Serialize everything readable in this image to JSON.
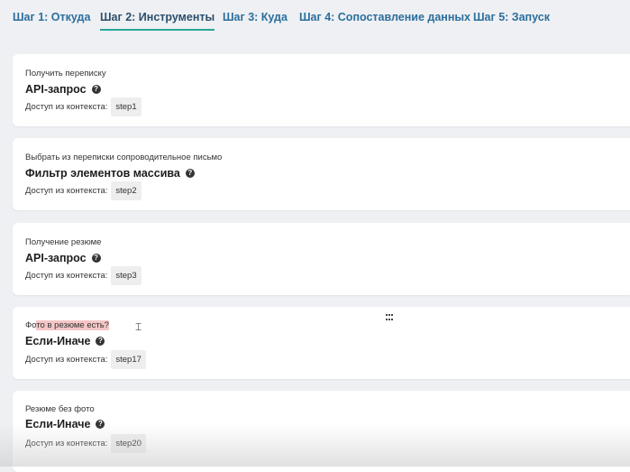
{
  "tabs": [
    {
      "label": "Шаг 1: Откуда",
      "active": false
    },
    {
      "label": "Шаг 2: Инструменты",
      "active": true
    },
    {
      "label": "Шаг 3: Куда",
      "active": false
    },
    {
      "label": "Шаг 4: Сопоставление данных",
      "active": false
    },
    {
      "label": "Шаг 5: Запуск",
      "active": false
    }
  ],
  "context_label": "Доступ из контекста:",
  "steps": [
    {
      "subtitle": "Получить переписку",
      "title": "API-запрос",
      "context": "step1"
    },
    {
      "subtitle": "Выбрать из переписки сопроводительное письмо",
      "title": "Фильтр элементов массива",
      "context": "step2"
    },
    {
      "subtitle": "Получение резюме",
      "title": "API-запрос",
      "context": "step3"
    },
    {
      "subtitle_plain": "Фо",
      "subtitle_highlight": "то в резюме есть?",
      "title": "Если-Иначе",
      "context": "step17"
    },
    {
      "subtitle": "Резюме без фото",
      "title": "Если-Иначе",
      "context": "step20"
    }
  ],
  "icons": {
    "help": "question-circle-icon",
    "text_cursor": "text-cursor-icon",
    "drag_handle": "grid-dots-icon"
  },
  "colors": {
    "tab_text": "#2c6e9c",
    "tab_active_underline": "#2aa69a",
    "selection_highlight": "#f5c6c6",
    "background": "#eef0f3"
  }
}
